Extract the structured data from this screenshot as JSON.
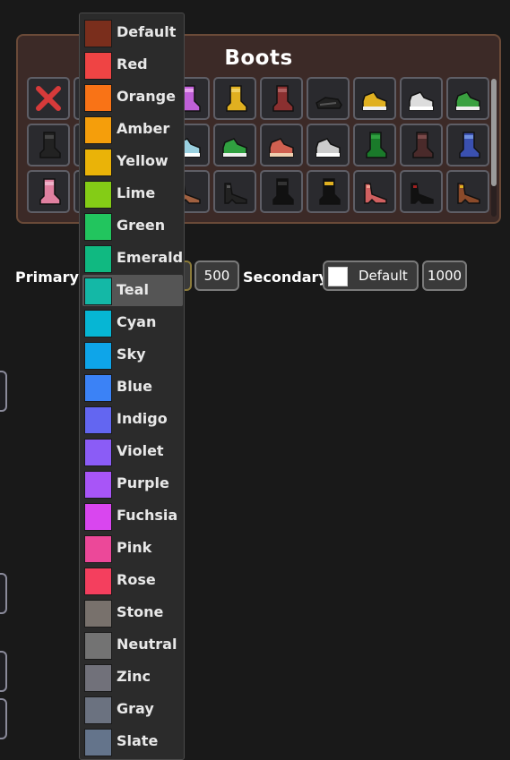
{
  "panel": {
    "title": "Boots"
  },
  "slots": [
    {
      "name": "none-x-icon",
      "colors": [
        "#d63a3a",
        "#d63a3a"
      ]
    },
    {
      "name": "boot-icon",
      "colors": [
        "#222",
        "#666"
      ]
    },
    {
      "name": "boot-icon",
      "colors": [
        "#222",
        "#666"
      ]
    },
    {
      "name": "boot-icon",
      "colors": [
        "#c060d8",
        "#e8a0f0"
      ]
    },
    {
      "name": "boot-icon",
      "colors": [
        "#e0b020",
        "#f0d060"
      ]
    },
    {
      "name": "boot-icon",
      "colors": [
        "#8a3030",
        "#b06060"
      ]
    },
    {
      "name": "shoe-icon",
      "colors": [
        "#222",
        "#555"
      ]
    },
    {
      "name": "sneaker-icon",
      "colors": [
        "#e0b020",
        "#eee"
      ]
    },
    {
      "name": "sneaker-icon",
      "colors": [
        "#ddd",
        "#fff"
      ]
    },
    {
      "name": "sneaker-icon",
      "colors": [
        "#3aa040",
        "#eee"
      ]
    },
    {
      "name": "boot-icon",
      "colors": [
        "#222",
        "#444"
      ]
    },
    {
      "name": "boot-icon",
      "colors": [
        "#222",
        "#444"
      ]
    },
    {
      "name": "boot-icon",
      "colors": [
        "#222",
        "#444"
      ]
    },
    {
      "name": "sneaker-icon",
      "colors": [
        "#9ad0e0",
        "#fff"
      ]
    },
    {
      "name": "sneaker-icon",
      "colors": [
        "#30a040",
        "#eee"
      ]
    },
    {
      "name": "sneaker-icon",
      "colors": [
        "#d06050",
        "#f0d0b0"
      ]
    },
    {
      "name": "sneaker-icon",
      "colors": [
        "#ccc",
        "#fff"
      ]
    },
    {
      "name": "boot-icon",
      "colors": [
        "#1a7a2a",
        "#30a040"
      ]
    },
    {
      "name": "boot-icon",
      "colors": [
        "#4a2a2a",
        "#7a4a4a"
      ]
    },
    {
      "name": "boot-icon",
      "colors": [
        "#3a50b0",
        "#7090e0"
      ]
    },
    {
      "name": "boot-icon",
      "colors": [
        "#e080a0",
        "#f0b0c8"
      ]
    },
    {
      "name": "heel-icon",
      "colors": [
        "#222",
        "#444"
      ]
    },
    {
      "name": "heel-icon",
      "colors": [
        "#222",
        "#444"
      ]
    },
    {
      "name": "heel-icon",
      "colors": [
        "#a06040",
        "#c08060"
      ]
    },
    {
      "name": "heel-icon",
      "colors": [
        "#222",
        "#555"
      ]
    },
    {
      "name": "boot-icon",
      "colors": [
        "#111",
        "#333"
      ]
    },
    {
      "name": "boot-icon",
      "colors": [
        "#111",
        "#e0b020"
      ]
    },
    {
      "name": "heel-icon",
      "colors": [
        "#d06060",
        "#f0a090"
      ]
    },
    {
      "name": "heel-icon",
      "colors": [
        "#111",
        "#a02020"
      ]
    },
    {
      "name": "heel-icon",
      "colors": [
        "#8a4a2a",
        "#e0b020"
      ]
    }
  ],
  "colors_row": {
    "primary_label": "Primary:",
    "primary_value": "500",
    "secondary_label": "Secondary:",
    "secondary_color_name": "Default",
    "secondary_value": "1000"
  },
  "dropdown": {
    "selected": "Teal",
    "options": [
      {
        "name": "Default",
        "color": "#7a2e1c"
      },
      {
        "name": "Red",
        "color": "#ef4444"
      },
      {
        "name": "Orange",
        "color": "#f97316"
      },
      {
        "name": "Amber",
        "color": "#f59e0b"
      },
      {
        "name": "Yellow",
        "color": "#eab308"
      },
      {
        "name": "Lime",
        "color": "#84cc16"
      },
      {
        "name": "Green",
        "color": "#22c55e"
      },
      {
        "name": "Emerald",
        "color": "#10b981"
      },
      {
        "name": "Teal",
        "color": "#14b8a6"
      },
      {
        "name": "Cyan",
        "color": "#06b6d4"
      },
      {
        "name": "Sky",
        "color": "#0ea5e9"
      },
      {
        "name": "Blue",
        "color": "#3b82f6"
      },
      {
        "name": "Indigo",
        "color": "#6366f1"
      },
      {
        "name": "Violet",
        "color": "#8b5cf6"
      },
      {
        "name": "Purple",
        "color": "#a855f7"
      },
      {
        "name": "Fuchsia",
        "color": "#d946ef"
      },
      {
        "name": "Pink",
        "color": "#ec4899"
      },
      {
        "name": "Rose",
        "color": "#f43f5e"
      },
      {
        "name": "Stone",
        "color": "#78716c"
      },
      {
        "name": "Neutral",
        "color": "#737373"
      },
      {
        "name": "Zinc",
        "color": "#71717a"
      },
      {
        "name": "Gray",
        "color": "#6b7280"
      },
      {
        "name": "Slate",
        "color": "#64748b"
      }
    ]
  }
}
